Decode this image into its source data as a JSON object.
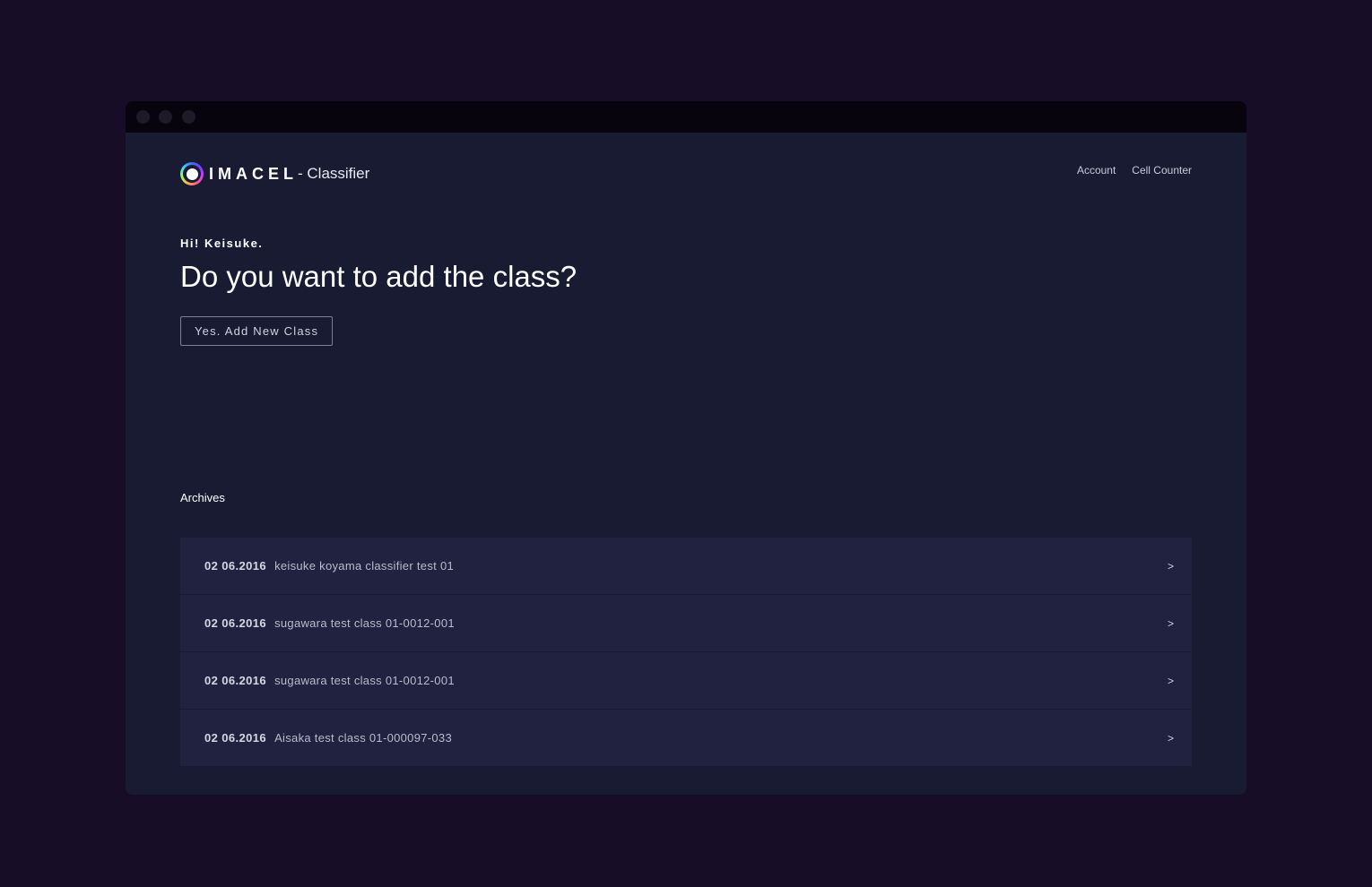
{
  "app": {
    "logo_text": "IMACEL",
    "logo_suffix": "- Classifier"
  },
  "nav": {
    "items": [
      {
        "label": "Account"
      },
      {
        "label": "Cell Counter"
      }
    ]
  },
  "main": {
    "greeting": "Hi! Keisuke.",
    "headline": "Do you want to add the class?",
    "add_button_label": "Yes. Add New Class"
  },
  "archives": {
    "title": "Archives",
    "rows": [
      {
        "date": "02 06.2016",
        "name": "keisuke koyama classifier test 01",
        "arrow": ">"
      },
      {
        "date": "02 06.2016",
        "name": "sugawara test class 01-0012-001",
        "arrow": ">"
      },
      {
        "date": "02 06.2016",
        "name": "sugawara test class 01-0012-001",
        "arrow": ">"
      },
      {
        "date": "02 06.2016",
        "name": "Aisaka test class 01-000097-033",
        "arrow": ">"
      }
    ]
  },
  "colors": {
    "page_background": "#170d26",
    "window_background": "#181b31",
    "titlebar": "#07040d",
    "row_background": "#20223f"
  }
}
